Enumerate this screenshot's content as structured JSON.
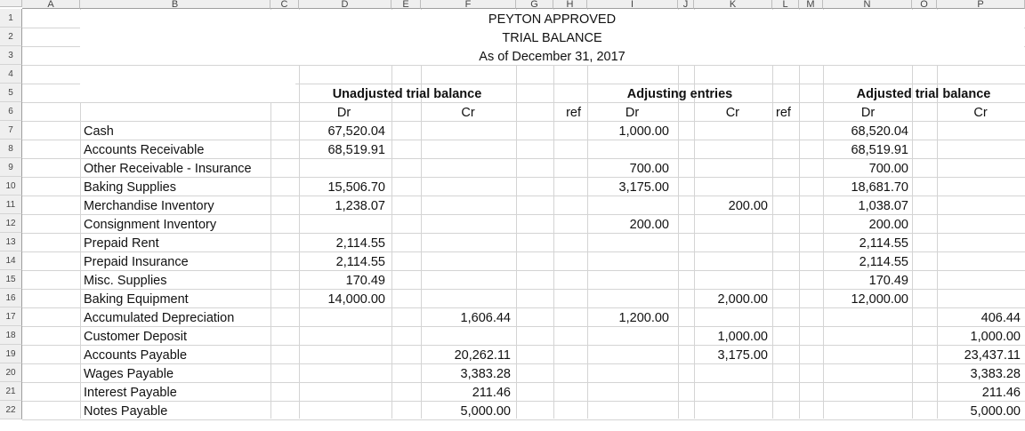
{
  "columns": [
    "A",
    "B",
    "C",
    "D",
    "E",
    "F",
    "G",
    "H",
    "I",
    "J",
    "K",
    "L",
    "M",
    "N",
    "O",
    "P"
  ],
  "rows": [
    "1",
    "2",
    "3",
    "4",
    "5",
    "6",
    "7",
    "8",
    "9",
    "10",
    "11",
    "12",
    "13",
    "14",
    "15",
    "16",
    "17",
    "18",
    "19",
    "20",
    "21",
    "22"
  ],
  "title": {
    "company": "PEYTON APPROVED",
    "report": "TRIAL BALANCE",
    "date": "As of December 31, 2017"
  },
  "sections": {
    "unadjusted": "Unadjusted trial balance",
    "adjusting": "Adjusting entries",
    "adjusted": "Adjusted trial balance"
  },
  "subheaders": {
    "u_dr": "Dr",
    "u_cr": "Cr",
    "ref1": "ref",
    "a_dr": "Dr",
    "a_cr": "Cr",
    "ref2": "ref",
    "t_dr": "Dr",
    "t_cr": "Cr"
  },
  "accounts": [
    {
      "name": "Cash",
      "u_dr": "67,520.04",
      "u_cr": "",
      "a_dr": "1,000.00",
      "a_cr": "",
      "t_dr": "68,520.04",
      "t_cr": ""
    },
    {
      "name": "Accounts Receivable",
      "u_dr": "68,519.91",
      "u_cr": "",
      "a_dr": "",
      "a_cr": "",
      "t_dr": "68,519.91",
      "t_cr": ""
    },
    {
      "name": "Other Receivable - Insurance",
      "u_dr": "",
      "u_cr": "",
      "a_dr": "700.00",
      "a_cr": "",
      "t_dr": "700.00",
      "t_cr": ""
    },
    {
      "name": "Baking Supplies",
      "u_dr": "15,506.70",
      "u_cr": "",
      "a_dr": "3,175.00",
      "a_cr": "",
      "t_dr": "18,681.70",
      "t_cr": ""
    },
    {
      "name": "Merchandise Inventory",
      "u_dr": "1,238.07",
      "u_cr": "",
      "a_dr": "",
      "a_cr": "200.00",
      "t_dr": "1,038.07",
      "t_cr": ""
    },
    {
      "name": "Consignment Inventory",
      "u_dr": "",
      "u_cr": "",
      "a_dr": "200.00",
      "a_cr": "",
      "t_dr": "200.00",
      "t_cr": ""
    },
    {
      "name": "Prepaid Rent",
      "u_dr": "2,114.55",
      "u_cr": "",
      "a_dr": "",
      "a_cr": "",
      "t_dr": "2,114.55",
      "t_cr": ""
    },
    {
      "name": "Prepaid Insurance",
      "u_dr": "2,114.55",
      "u_cr": "",
      "a_dr": "",
      "a_cr": "",
      "t_dr": "2,114.55",
      "t_cr": ""
    },
    {
      "name": "Misc. Supplies",
      "u_dr": "170.49",
      "u_cr": "",
      "a_dr": "",
      "a_cr": "",
      "t_dr": "170.49",
      "t_cr": ""
    },
    {
      "name": "Baking Equipment",
      "u_dr": "14,000.00",
      "u_cr": "",
      "a_dr": "",
      "a_cr": "2,000.00",
      "t_dr": "12,000.00",
      "t_cr": ""
    },
    {
      "name": "Accumulated Depreciation",
      "u_dr": "",
      "u_cr": "1,606.44",
      "a_dr": "1,200.00",
      "a_cr": "",
      "t_dr": "",
      "t_cr": "406.44"
    },
    {
      "name": "Customer Deposit",
      "u_dr": "",
      "u_cr": "",
      "a_dr": "",
      "a_cr": "1,000.00",
      "t_dr": "",
      "t_cr": "1,000.00"
    },
    {
      "name": "Accounts Payable",
      "u_dr": "",
      "u_cr": "20,262.11",
      "a_dr": "",
      "a_cr": "3,175.00",
      "t_dr": "",
      "t_cr": "23,437.11"
    },
    {
      "name": "Wages Payable",
      "u_dr": "",
      "u_cr": "3,383.28",
      "a_dr": "",
      "a_cr": "",
      "t_dr": "",
      "t_cr": "3,383.28"
    },
    {
      "name": "Interest Payable",
      "u_dr": "",
      "u_cr": "211.46",
      "a_dr": "",
      "a_cr": "",
      "t_dr": "",
      "t_cr": "211.46"
    },
    {
      "name": "Notes Payable",
      "u_dr": "",
      "u_cr": "5,000.00",
      "a_dr": "",
      "a_cr": "",
      "t_dr": "",
      "t_cr": "5,000.00"
    }
  ]
}
